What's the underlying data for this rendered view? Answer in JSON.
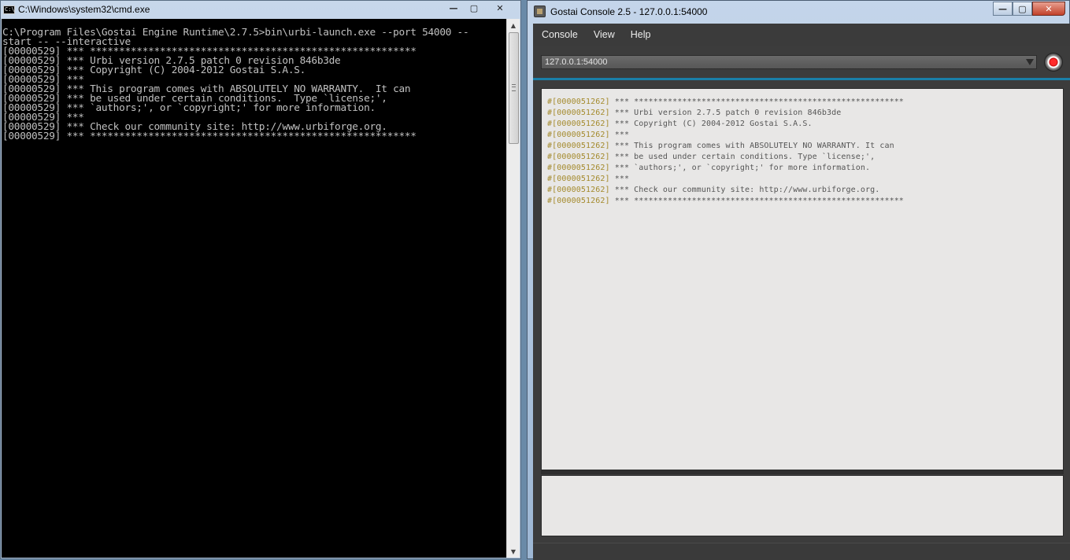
{
  "cmd": {
    "title": "C:\\Windows\\system32\\cmd.exe",
    "icon_label": "C:\\",
    "controls": {
      "minimize": "—",
      "maximize": "▢",
      "close": "✕"
    },
    "scroll_up": "▲",
    "scroll_down": "▼",
    "output": "C:\\Program Files\\Gostai Engine Runtime\\2.7.5>bin\\urbi-launch.exe --port 54000 --\nstart -- --interactive\n[00000529] *** ********************************************************\n[00000529] *** Urbi version 2.7.5 patch 0 revision 846b3de\n[00000529] *** Copyright (C) 2004-2012 Gostai S.A.S.\n[00000529] ***\n[00000529] *** This program comes with ABSOLUTELY NO WARRANTY.  It can\n[00000529] *** be used under certain conditions.  Type `license;',\n[00000529] *** `authors;', or `copyright;' for more information.\n[00000529] ***\n[00000529] *** Check our community site: http://www.urbiforge.org.\n[00000529] *** ********************************************************"
  },
  "gostai": {
    "title": "Gostai Console 2.5 - 127.0.0.1:54000",
    "controls": {
      "minimize": "—",
      "maximize": "▢",
      "close": "✕"
    },
    "menu": [
      "Console",
      "View",
      "Help"
    ],
    "connection": {
      "value": "127.0.0.1:54000"
    },
    "output_lines": [
      {
        "tag": "#[0000051262]",
        "text": " *** ********************************************************"
      },
      {
        "tag": "#[0000051262]",
        "text": " *** Urbi version 2.7.5 patch 0 revision 846b3de"
      },
      {
        "tag": "#[0000051262]",
        "text": " *** Copyright (C) 2004-2012 Gostai S.A.S."
      },
      {
        "tag": "#[0000051262]",
        "text": " ***"
      },
      {
        "tag": "#[0000051262]",
        "text": " *** This program comes with ABSOLUTELY NO WARRANTY. It can"
      },
      {
        "tag": "#[0000051262]",
        "text": " *** be used under certain conditions. Type `license;',"
      },
      {
        "tag": "#[0000051262]",
        "text": " *** `authors;', or `copyright;' for more information."
      },
      {
        "tag": "#[0000051262]",
        "text": " ***"
      },
      {
        "tag": "#[0000051262]",
        "text": " *** Check our community site: http://www.urbiforge.org."
      },
      {
        "tag": "#[0000051262]",
        "text": " *** ********************************************************"
      }
    ],
    "input_value": ""
  }
}
